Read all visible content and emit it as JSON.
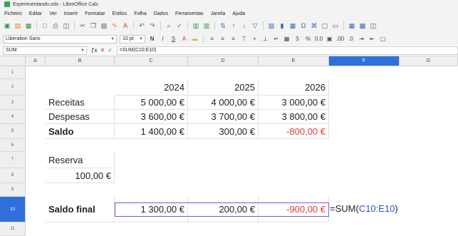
{
  "window": {
    "title": "Experimentando.ods - LibreOffice Calc"
  },
  "menu": [
    "Ficheiro",
    "Editar",
    "Ver",
    "Inserir",
    "Formatar",
    "Estilos",
    "Folha",
    "Dados",
    "Ferramentas",
    "Janela",
    "Ajuda"
  ],
  "format_bar": {
    "font_name": "Liberation Sans",
    "font_size": "10 pt"
  },
  "formula_bar": {
    "name_box": "SUM",
    "formula": "=SUM(C10:E10)"
  },
  "columns": [
    "A",
    "B",
    "C",
    "D",
    "E",
    "F",
    "G"
  ],
  "rows": [
    "1",
    "2",
    "3",
    "4",
    "5",
    "6",
    "7",
    "8",
    "9",
    "10",
    "11"
  ],
  "cells": {
    "C2": "2024",
    "D2": "2025",
    "E2": "2026",
    "B3": "Receitas",
    "C3": "5 000,00 €",
    "D3": "4 000,00 €",
    "E3": "3 000,00 €",
    "B4": "Despesas",
    "C4": "3 600,00 €",
    "D4": "3 700,00 €",
    "E4": "3 800,00 €",
    "B5": "Saldo",
    "C5": "1 400,00 €",
    "D5": "300,00 €",
    "E5": "-800,00 €",
    "B7": "Reserva",
    "B8": "100,00 €",
    "B10": "Saldo final",
    "C10": "1 300,00 €",
    "D10": "200,00 €",
    "E10": "-900,00 €"
  },
  "editing_formula": {
    "prefix": "=SUM(",
    "range": "C10:E10",
    "suffix": ")"
  },
  "colors": {
    "active_header": "#2f6fdb",
    "negative": "#e03a3a",
    "range_ref": "#2a55c8",
    "selection_border": "#7b5bd1"
  }
}
